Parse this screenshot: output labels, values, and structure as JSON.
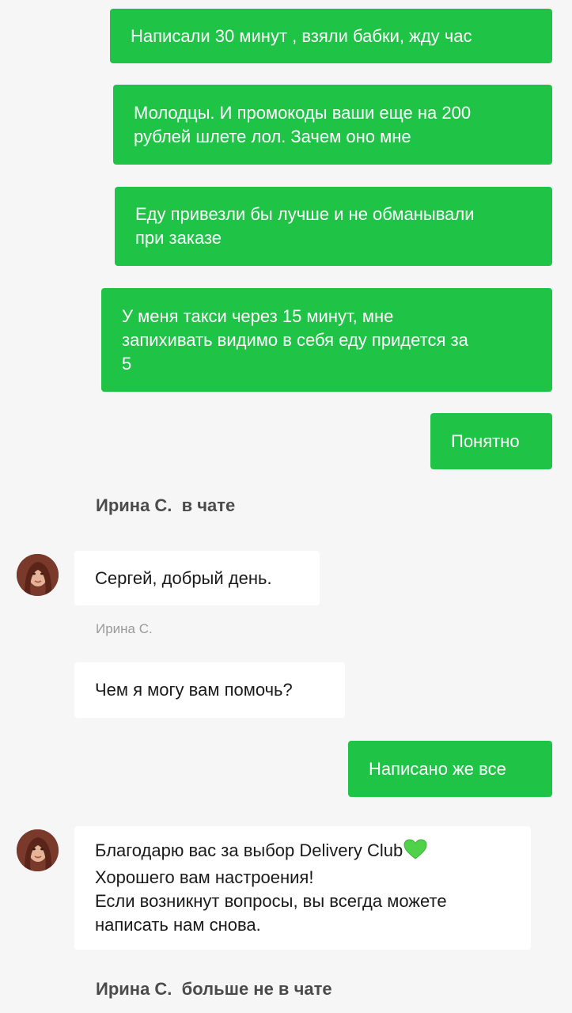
{
  "messages": {
    "out_1": "Написали 30 минут , взяли бабки, жду час",
    "out_2": "Молодцы. И промокоды ваши еще на 200\nрублей шлете лол. Зачем оно мне",
    "out_3": "Еду привезли бы лучше и не обманывали\nпри заказе",
    "out_4": "У меня такси через 15 минут, мне\nзапихивать видимо в себя еду придется за\n5",
    "out_5": "Понятно",
    "in_1": "Сергей, добрый день.",
    "in_2": "Чем я могу вам помочь?",
    "out_6": "Написано же все",
    "in_3_line1": "Благодарю вас за выбор Delivery Club",
    "in_3_rest": "Хорошего вам настроения!\nЕсли возникнут вопросы, вы всегда можете\nнаписать нам снова."
  },
  "system": {
    "joined": "Ирина С.  в чате",
    "left": "Ирина С.  больше не в чате"
  },
  "operator": {
    "name": "Ирина С."
  },
  "icons": {
    "heart": "green-heart-icon",
    "avatar": "operator-avatar"
  },
  "colors": {
    "outgoing_bubble": "#1fc447",
    "incoming_bubble": "#ffffff",
    "background": "#f6f6f6",
    "heart": "#4fd14a"
  }
}
